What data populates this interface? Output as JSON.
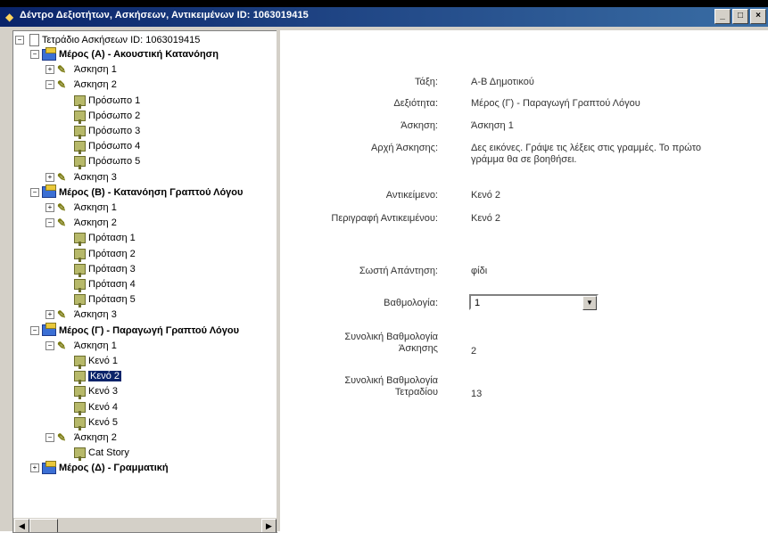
{
  "window": {
    "title": "Δέντρο Δεξιοτήτων, Ασκήσεων, Αντικειμένων ID: 1063019415",
    "minimize_label": "_",
    "maximize_label": "□",
    "close_label": "×"
  },
  "tree": {
    "root": "Τετράδιο Ασκήσεων ID: 1063019415",
    "nodes": [
      {
        "label": "Μέρος (Α) - Ακουστική Κατανόηση",
        "bold": true
      },
      {
        "label": "Άσκηση 1"
      },
      {
        "label": "Άσκηση 2"
      },
      {
        "label": "Πρόσωπο 1"
      },
      {
        "label": "Πρόσωπο 2"
      },
      {
        "label": "Πρόσωπο 3"
      },
      {
        "label": "Πρόσωπο 4"
      },
      {
        "label": "Πρόσωπο 5"
      },
      {
        "label": "Άσκηση 3"
      },
      {
        "label": "Μέρος (Β) - Κατανόηση Γραπτού Λόγου",
        "bold": true
      },
      {
        "label": "Άσκηση 1"
      },
      {
        "label": "Άσκηση 2"
      },
      {
        "label": "Πρόταση 1"
      },
      {
        "label": "Πρόταση 2"
      },
      {
        "label": "Πρόταση 3"
      },
      {
        "label": "Πρόταση 4"
      },
      {
        "label": "Πρόταση 5"
      },
      {
        "label": "Άσκηση 3"
      },
      {
        "label": "Μέρος (Γ) - Παραγωγή Γραπτού Λόγου",
        "bold": true
      },
      {
        "label": "Άσκηση 1"
      },
      {
        "label": "Κενό 1"
      },
      {
        "label": "Κενό 2",
        "selected": true
      },
      {
        "label": "Κενό 3"
      },
      {
        "label": "Κενό 4"
      },
      {
        "label": "Κενό 5"
      },
      {
        "label": "Άσκηση 2"
      },
      {
        "label": "Cat Story"
      },
      {
        "label": "Μέρος (Δ) - Γραμματική",
        "bold": true
      }
    ]
  },
  "details": {
    "class_label": "Τάξη:",
    "class_value": "Α-Β Δημοτικού",
    "skill_label": "Δεξιότητα:",
    "skill_value": "Μέρος (Γ) - Παραγωγή Γραπτού Λόγου",
    "exercise_label": "Άσκηση:",
    "exercise_value": "Άσκηση 1",
    "instruction_label": "Αρχή Άσκησης:",
    "instruction_value": "Δες εικόνες. Γράψε τις λέξεις στις γραμμές. Το πρώτο γράμμα θα σε βοηθήσει.",
    "object_label": "Αντικείμενο:",
    "object_value": "Κενό 2",
    "object_desc_label": "Περιγραφή Αντικειμένου:",
    "object_desc_value": "Κενό 2",
    "correct_label": "Σωστή Απάντηση:",
    "correct_value": "φίδι",
    "score_label": "Βαθμολογία:",
    "score_value": "1",
    "total_ex_label_1": "Συνολική Βαθμολογία",
    "total_ex_label_2": "Άσκησης",
    "total_ex_value": "2",
    "total_wb_label_1": "Συνολική Βαθμολογία",
    "total_wb_label_2": "Τετραδίου",
    "total_wb_value": "13"
  }
}
